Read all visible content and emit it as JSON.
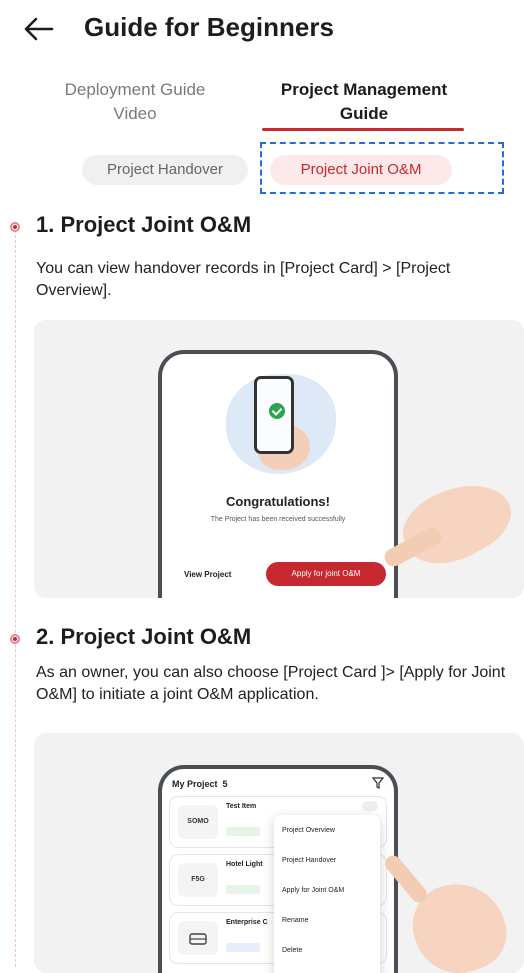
{
  "header": {
    "title": "Guide for Beginners",
    "back_icon": "arrow-left-icon"
  },
  "tabs": [
    {
      "label": "Deployment Guide\nVideo",
      "active": false
    },
    {
      "label": "Project Management\nGuide",
      "active": true
    }
  ],
  "sub_tabs": [
    {
      "label": "Project Handover",
      "active": false
    },
    {
      "label": "Project Joint O&M",
      "active": true
    }
  ],
  "sections": [
    {
      "title": "1. Project Joint O&M",
      "description": "You can view handover records in [Project Card] > [Project Overview].",
      "illustration": {
        "congrats_title": "Congratulations!",
        "congrats_sub": "The Project has been received successfully",
        "view_project": "View Project",
        "apply_button": "Apply for joint O&M"
      }
    },
    {
      "title": "2. Project Joint O&M",
      "description": "As an owner, you can also choose [Project Card ]> [Apply for Joint O&M] to initiate a joint O&M application.",
      "illustration": {
        "list_title": "My Project  5",
        "projects": [
          {
            "name": "Test Item",
            "logo": "SOMO"
          },
          {
            "name": "Hotel Light",
            "logo": "F5G"
          },
          {
            "name": "Enterprise C",
            "logo": ""
          }
        ],
        "menu": [
          "Project Overview",
          "Project Handover",
          "Apply for Joint O&M",
          "Rename",
          "Delete"
        ]
      }
    }
  ],
  "colors": {
    "accent": "#c8282f",
    "highlight_box": "#1f6fd6"
  }
}
